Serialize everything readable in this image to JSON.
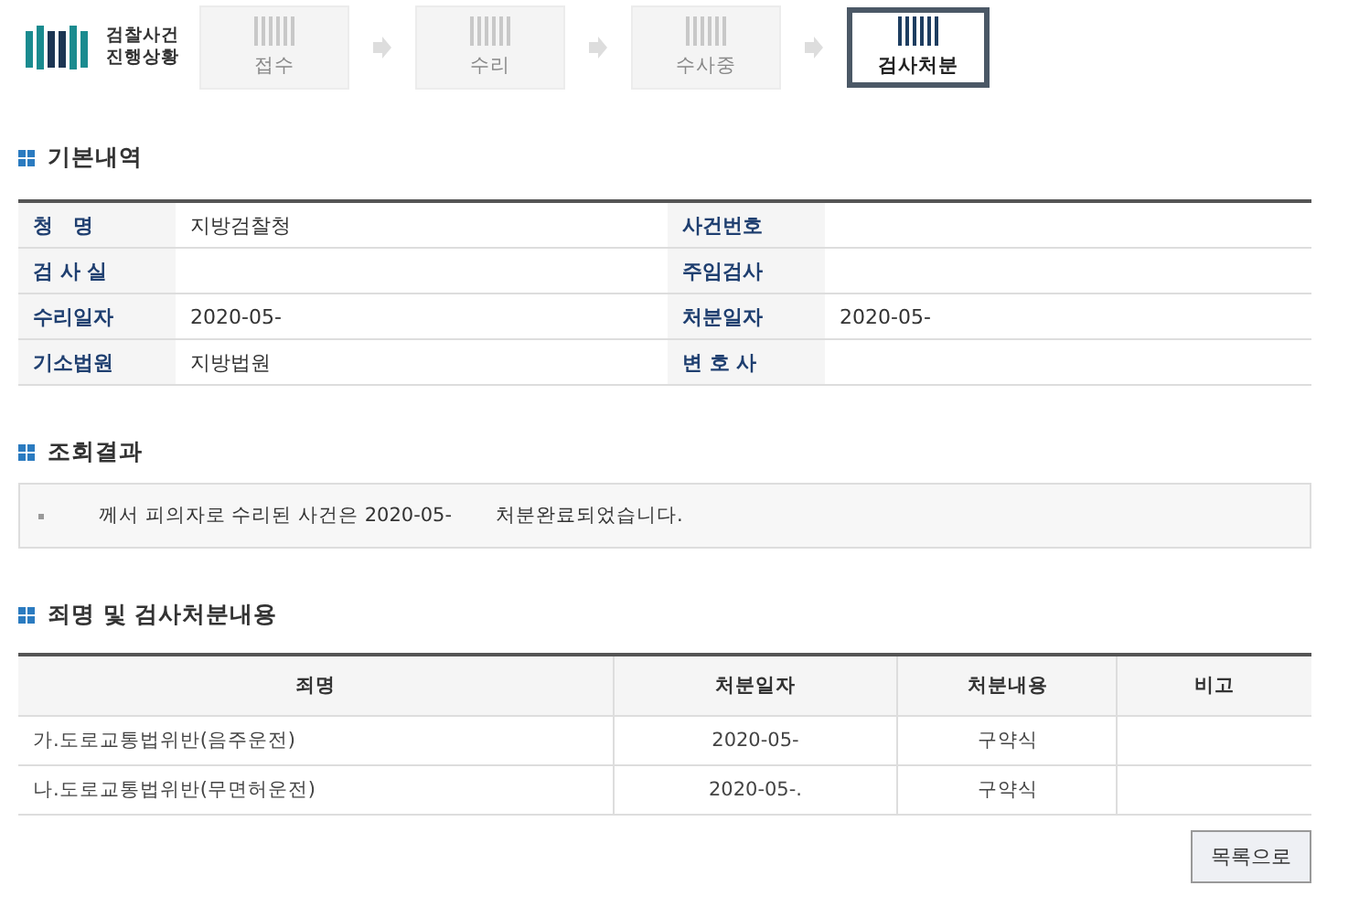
{
  "logo": {
    "lines": [
      "검찰사건",
      "진행상황"
    ]
  },
  "steps": [
    {
      "label": "접수",
      "selected": false
    },
    {
      "label": "수리",
      "selected": false
    },
    {
      "label": "수사중",
      "selected": false
    },
    {
      "label": "검사처분",
      "selected": true
    }
  ],
  "basic_info": {
    "title": "기본내역",
    "rows": [
      {
        "label_1": "청　명",
        "value_1": "지방검찰청",
        "label_2": "사건번호",
        "value_2": ""
      },
      {
        "label_1": "검 사 실",
        "value_1": "",
        "label_2": "주임검사",
        "value_2": ""
      },
      {
        "label_1": "수리일자",
        "value_1": "2020-05-",
        "label_2": "처분일자",
        "value_2": "2020-05-"
      },
      {
        "label_1": "기소법원",
        "value_1": "지방법원",
        "label_2": "변 호 사",
        "value_2": ""
      }
    ]
  },
  "result": {
    "title": "조회결과",
    "parts": [
      "께서 피의자로 수리된 사건은 2020-05-",
      "처분완료되었습니다."
    ]
  },
  "charges": {
    "title": "죄명 및 검사처분내용",
    "columns": [
      "죄명",
      "처분일자",
      "처분내용",
      "비고"
    ],
    "rows": [
      [
        "가.도로교통법위반(음주운전)",
        "2020-05-",
        "구약식",
        ""
      ],
      [
        "나.도로교통법위반(무면허운전)",
        "2020-05-.",
        "구약식",
        ""
      ]
    ]
  },
  "list_button": "목록으로"
}
